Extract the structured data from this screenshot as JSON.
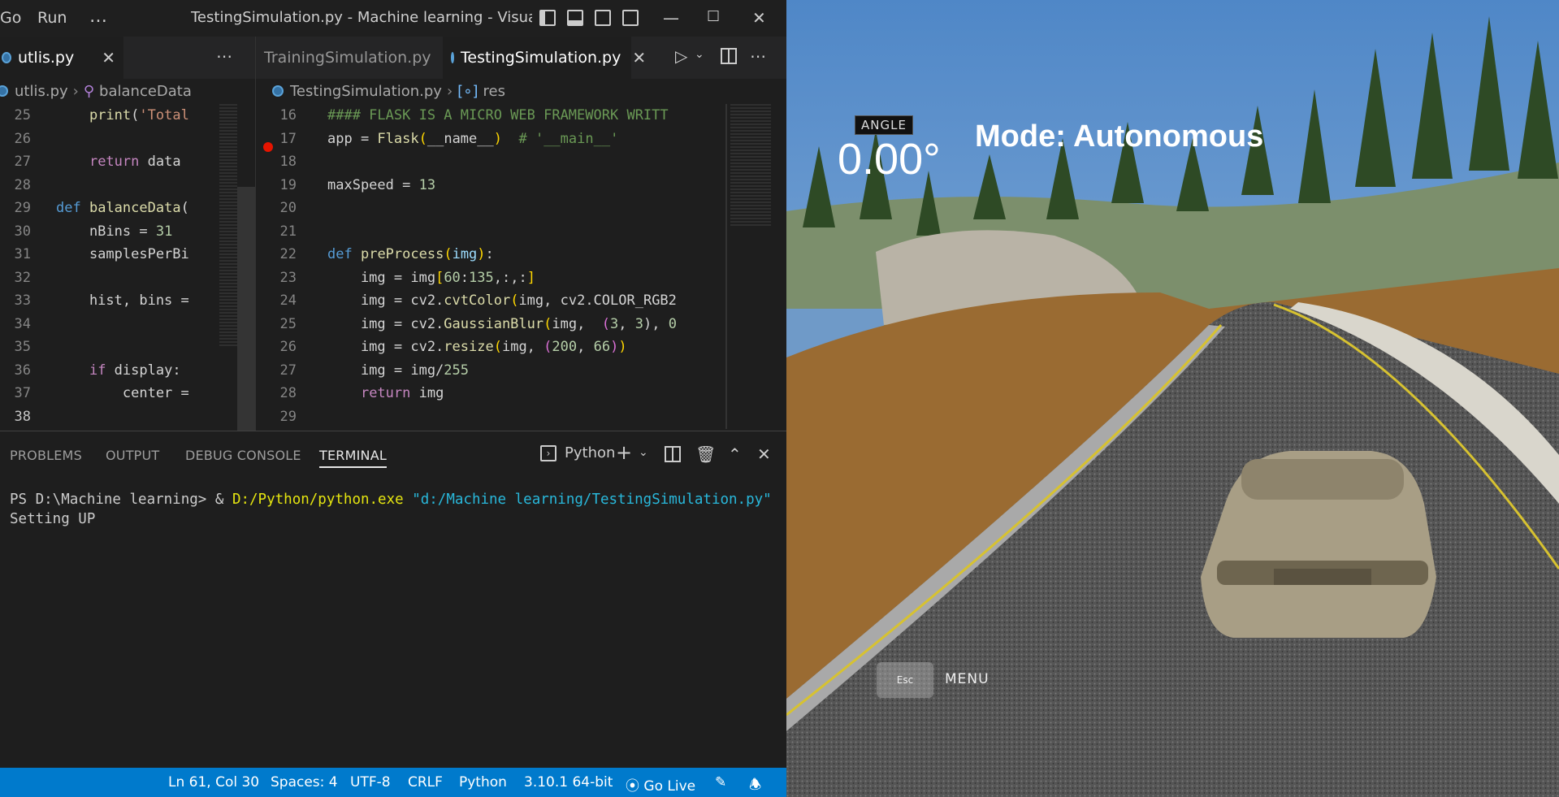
{
  "titlebar": {
    "menu": [
      "Go",
      "Run",
      "…"
    ],
    "title": "TestingSimulation.py - Machine learning - Visual St..."
  },
  "left_group": {
    "tab": "utlis.py",
    "breadcrumb": [
      "utlis.py",
      "balanceData"
    ],
    "lines": [
      {
        "n": "25",
        "html": "    <span class=\"fn\">print</span>(<span class=\"str\">'Total</span>"
      },
      {
        "n": "26",
        "html": ""
      },
      {
        "n": "27",
        "html": "    <span class=\"kw\">return</span> data"
      },
      {
        "n": "28",
        "html": ""
      },
      {
        "n": "29",
        "html": "<span class=\"def\">def</span> <span class=\"fn\">balanceData</span>("
      },
      {
        "n": "30",
        "html": "    nBins = <span class=\"num\">31</span>"
      },
      {
        "n": "31",
        "html": "    samplesPerBi"
      },
      {
        "n": "32",
        "html": ""
      },
      {
        "n": "33",
        "html": "    hist, bins ="
      },
      {
        "n": "34",
        "html": ""
      },
      {
        "n": "35",
        "html": ""
      },
      {
        "n": "36",
        "html": "    <span class=\"kw\">if</span> display:"
      },
      {
        "n": "37",
        "html": "        center ="
      },
      {
        "n": "38",
        "html": ""
      }
    ]
  },
  "right_group": {
    "tabs": [
      "TrainingSimulation.py",
      "TestingSimulation.py"
    ],
    "breadcrumb": [
      "TestingSimulation.py",
      "res"
    ],
    "lines": [
      {
        "n": "16",
        "html": "<span class=\"cmt\">#### FLASK IS A MICRO WEB FRAMEWORK WRITT</span>"
      },
      {
        "n": "17",
        "html": "app = <span class=\"fn\">Flask</span><span class=\"paren\">(</span>__name__<span class=\"paren\">)</span>  <span class=\"cmt\"># '__main__'</span>"
      },
      {
        "n": "18",
        "html": ""
      },
      {
        "n": "19",
        "html": "maxSpeed = <span class=\"num\">13</span>"
      },
      {
        "n": "20",
        "html": ""
      },
      {
        "n": "21",
        "html": ""
      },
      {
        "n": "22",
        "html": "<span class=\"def\">def</span> <span class=\"fn\">preProcess</span><span class=\"paren\">(</span><span class=\"param\">img</span><span class=\"paren\">)</span>:"
      },
      {
        "n": "23",
        "html": "    img = img<span class=\"paren\">[</span><span class=\"num\">60</span>:<span class=\"num\">135</span>,:,:<span class=\"paren\">]</span>"
      },
      {
        "n": "24",
        "html": "    img = cv2.<span class=\"fn\">cvtColor</span><span class=\"paren\">(</span>img, cv2.COLOR_RGB2"
      },
      {
        "n": "25",
        "html": "    img = cv2.<span class=\"fn\">GaussianBlur</span><span class=\"paren\">(</span>img,  <span class=\"paren2\">(</span><span class=\"num\">3</span>, <span class=\"num\">3</span>), <span class=\"num\">0</span>"
      },
      {
        "n": "26",
        "html": "    img = cv2.<span class=\"fn\">resize</span><span class=\"paren\">(</span>img, <span class=\"paren2\">(</span><span class=\"num\">200</span>, <span class=\"num\">66</span><span class=\"paren2\">)</span><span class=\"paren\">)</span>"
      },
      {
        "n": "27",
        "html": "    img = img/<span class=\"num\">255</span>"
      },
      {
        "n": "28",
        "html": "    <span class=\"kw\">return</span> img"
      },
      {
        "n": "29",
        "html": ""
      }
    ]
  },
  "panel": {
    "tabs": [
      "PROBLEMS",
      "OUTPUT",
      "DEBUG CONSOLE",
      "TERMINAL"
    ],
    "active_tab": "TERMINAL",
    "terminal_kind": "Python",
    "prompt": "PS D:\\Machine learning> & ",
    "exe": "D:/Python/python.exe",
    "script": " \"d:/Machine learning/TestingSimulation.py\"",
    "output": "Setting UP"
  },
  "statusbar": {
    "position": "Ln 61, Col 30",
    "spaces": "Spaces: 4",
    "encoding": "UTF-8",
    "eol": "CRLF",
    "language": "Python",
    "interpreter": "3.10.1 64-bit",
    "go_live": "Go Live"
  },
  "simulator": {
    "angle_label": "ANGLE",
    "angle_value": "0.00°",
    "mode": "Mode: Autonomous",
    "esc": "Esc",
    "menu": "MENU"
  }
}
